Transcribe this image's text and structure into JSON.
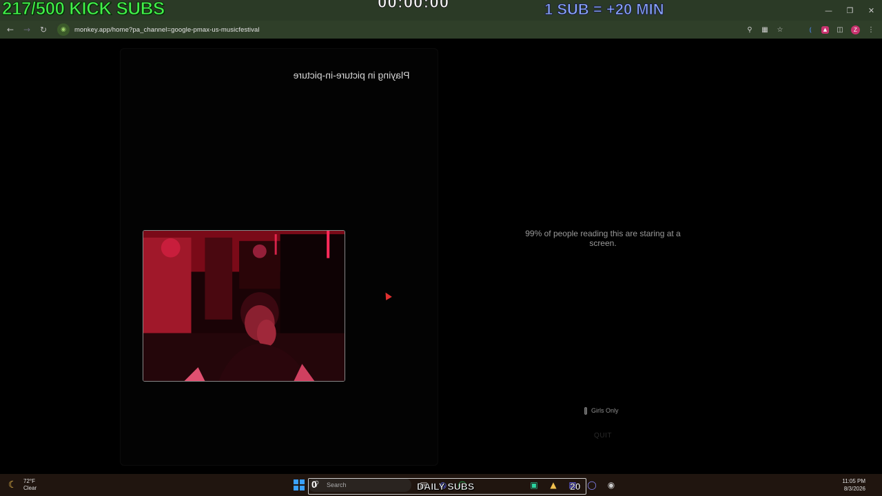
{
  "overlay": {
    "subs_goal": "217/500 KICK SUBS",
    "timer": "00:00:00",
    "rate": "1 SUB = +20 MIN"
  },
  "browser": {
    "url": "monkey.app/home?pa_channel=google-pmax-us-musicfestival",
    "profile_initial": "Z"
  },
  "page": {
    "pip_label": "Playing in picture-in-picture",
    "message": "99% of people reading this are staring at a screen.",
    "girls_only_label": "Girls Only",
    "quit_label": "QUIT"
  },
  "taskbar": {
    "weather_temp": "72°F",
    "weather_cond": "Clear",
    "search_label": "Search",
    "daily_subs_label": "DAILY SUBS",
    "daily_subs_left": "0",
    "daily_subs_count": "20",
    "time": "11:05 PM",
    "date": "8/3/2026"
  },
  "icons": {
    "back": "arrow-left-icon",
    "forward": "arrow-right-icon",
    "reload": "reload-icon",
    "zoom": "magnify-icon",
    "install": "install-app-icon",
    "bookmark": "star-icon",
    "extensions": "puzzle-icon",
    "menu": "kebab-menu-icon"
  },
  "colors": {
    "subs_green": "#42f14a",
    "rate_blue": "#8ca7ff",
    "toolbar": "#2f3f29",
    "titlebar": "#2b3a26"
  }
}
